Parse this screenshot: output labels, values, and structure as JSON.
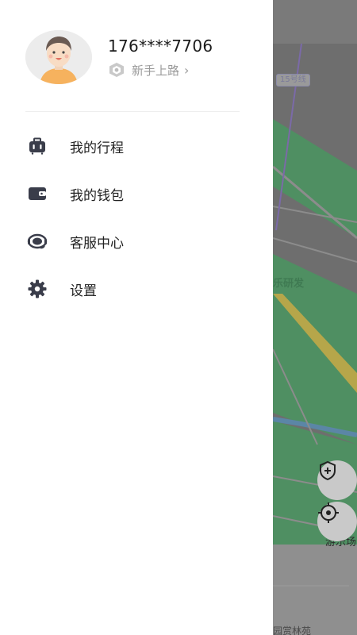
{
  "user": {
    "phone": "176****7706",
    "level": "新手上路",
    "level_chevron": "›",
    "avatar_icon": "avatar-boy-icon"
  },
  "menu": {
    "items": [
      {
        "label": "我的行程",
        "icon": "luggage-icon"
      },
      {
        "label": "我的钱包",
        "icon": "wallet-icon"
      },
      {
        "label": "客服中心",
        "icon": "headset-icon"
      },
      {
        "label": "设置",
        "icon": "gear-icon"
      }
    ]
  },
  "map": {
    "line_badge": "15号线",
    "label_1": "乐研发",
    "label_2": "游乐场",
    "label_3": "园赏林苑",
    "colors": {
      "green": "#4f8f62",
      "road": "#b6a64a",
      "water": "#5b86a6"
    }
  }
}
